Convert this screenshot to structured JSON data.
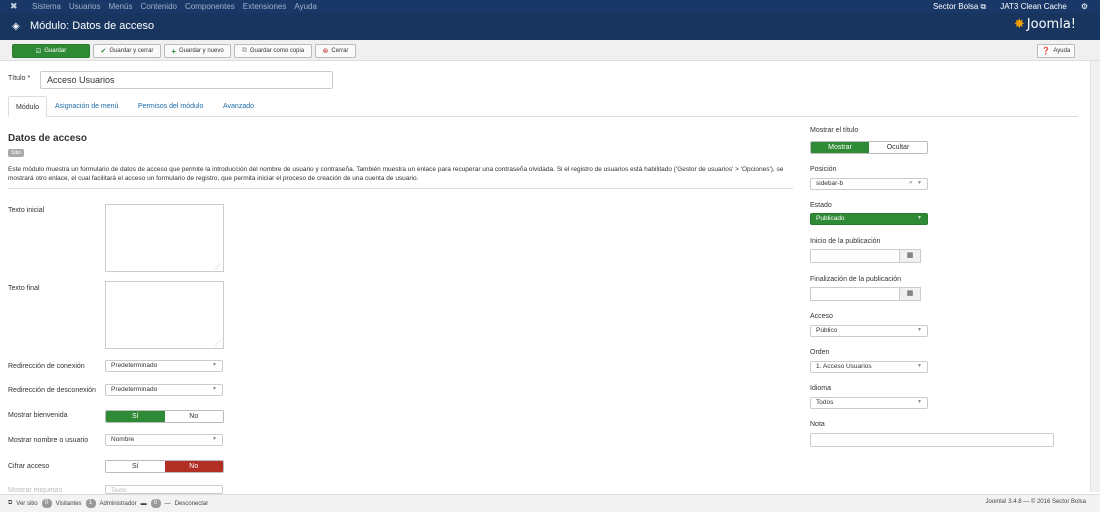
{
  "topnav": {
    "menu": [
      "Sistema",
      "Usuarios",
      "Menús",
      "Contenido",
      "Componentes",
      "Extensiones",
      "Ayuda"
    ],
    "site_link": "Sector Bolsa",
    "cache_label": "JAT3 Clean Cache"
  },
  "header": {
    "title": "Módulo: Datos de acceso",
    "logo": "Joomla!"
  },
  "toolbar": {
    "save": "Guardar",
    "save_close": "Guardar y cerrar",
    "save_new": "Guardar y nuevo",
    "save_copy": "Guardar como copia",
    "close": "Cerrar",
    "help": "Ayuda"
  },
  "form": {
    "title_label": "Título *",
    "title_value": "Acceso Usuarios"
  },
  "tabs": [
    "Módulo",
    "Asignación de menú",
    "Permisos del módulo",
    "Avanzado"
  ],
  "module": {
    "name": "Datos de acceso",
    "badge": "Sitio",
    "description": "Este módulo muestra un formulario de datos de acceso que permite la introducción del nombre de usuario y contraseña. También muestra un enlace para recuperar una contraseña olvidada. Si el registro de usuarios está habilitado ('Gestor de usuarios' > 'Opciones'), se mostrará otro enlace, el cual facilitará el acceso un formulario de registro, que permita iniciar el proceso de creación de una cuenta de usuario."
  },
  "fields": {
    "pretext_label": "Texto inicial",
    "posttext_label": "Texto final",
    "login_redirect_label": "Redirección de conexión",
    "login_redirect_value": "Predeterminado",
    "logout_redirect_label": "Redirección de desconexión",
    "logout_redirect_value": "Predeterminado",
    "greeting_label": "Mostrar bienvenida",
    "greeting_yes": "Sí",
    "greeting_no": "No",
    "name_label": "Mostrar nombre o usuario",
    "name_value": "Nombre",
    "secure_label": "Cifrar acceso",
    "secure_yes": "Sí",
    "secure_no": "No",
    "icons_label": "Mostrar etiquetas",
    "icons_value": "Texto"
  },
  "sidebar": {
    "show_title_label": "Mostrar el título",
    "show_title_on": "Mostrar",
    "show_title_off": "Ocultar",
    "position_label": "Posición",
    "position_value": "sidebar-b",
    "status_label": "Estado",
    "status_value": "Publicado",
    "publish_up_label": "Inicio de la publicación",
    "publish_down_label": "Finalización de la publicación",
    "access_label": "Acceso",
    "access_value": "Público",
    "ordering_label": "Orden",
    "ordering_value": "1. Acceso Usuarios",
    "language_label": "Idioma",
    "language_value": "Todos",
    "note_label": "Nota"
  },
  "statusbar": {
    "view_site": "Ver sitio",
    "visitors_count": "0",
    "visitors_label": "Visitantes",
    "admins_count": "1",
    "admins_label": "Administrador",
    "messages_count": "0",
    "logout": "Desconectar",
    "version": "Joomla! 3.4.8 — © 2016 Sector Bolsa"
  }
}
